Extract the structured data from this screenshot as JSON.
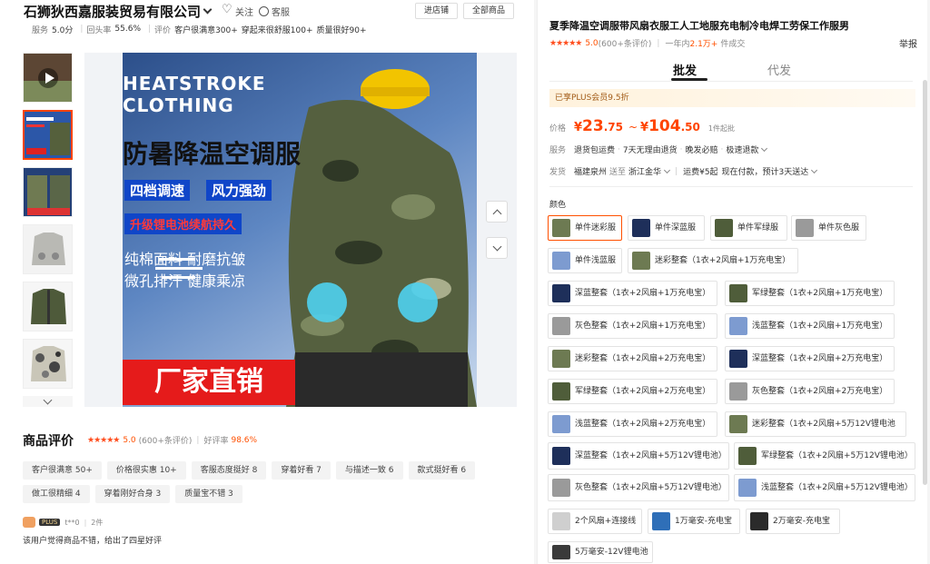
{
  "shop": {
    "name": "石狮狄西嘉服装贸易有限公司",
    "follow": "关注",
    "service": "客服",
    "enter_store": "进店铺",
    "all_products": "全部商品"
  },
  "ratings": {
    "service_label": "服务",
    "service_score": "5.0分",
    "repeat_label": "回头率",
    "repeat_value": "55.6%",
    "review_label": "评价",
    "tags": [
      "客户很满意300+",
      "穿起来很舒服100+",
      "质量很好90+"
    ]
  },
  "gallery": {
    "thumb_icons": [
      "video-thumb-icon",
      "thumb-blue-icon",
      "thumb-camo-icon",
      "thumb-grey-icon",
      "thumb-green-icon",
      "thumb-camo2-icon"
    ],
    "banner_en1": "HEATSTROKE",
    "banner_en2": "CLOTHING",
    "banner_title": "防暑降温空调服",
    "badge1": "四档调速",
    "badge2": "风力强劲",
    "badge3": "升级锂电池续航持久",
    "feat1": "纯棉面料 耐磨抗皱",
    "feat2": "微孔排汗 健康乘凉",
    "bottom_banner": "厂家直销"
  },
  "reviews": {
    "title": "商品评价",
    "score": "5.0",
    "count": "(600+条评价)",
    "good_label": "好评率",
    "good_rate": "98.6%",
    "tags": [
      "客户很满意 50+",
      "价格很实惠 10+",
      "客服态度挺好 8",
      "穿着好看 7",
      "与描述一致 6",
      "款式挺好看 6",
      "做工很精细 4",
      "穿着刚好合身 3",
      "质量宝不错 3"
    ],
    "user_badge": "PLUS",
    "user_name": "t**0",
    "user_count": "2件",
    "text": "该用户觉得商品不错，给出了四星好评"
  },
  "product": {
    "title": "夏季降温空调服带风扇衣服工人工地服充电制冷电焊工劳保工作服男",
    "score": "5.0",
    "count": "(600+条评价)",
    "sales_prefix": "一年内",
    "sales": "2.1万+",
    "sales_suffix": "件成交",
    "report": "举报",
    "tabs": [
      "批发",
      "代发"
    ],
    "plus_bar": "已享PLUS会员9.5折",
    "price_label": "价格",
    "currency": "¥",
    "price_low_int": "23",
    "price_low_dec": ".75",
    "tilde": "~",
    "price_high_int": "104",
    "price_high_dec": ".50",
    "min_order": "1件起批",
    "service_label": "服务",
    "services": [
      "退货包运费",
      "7天无理由退货",
      "晚发必赔",
      "极速退款"
    ],
    "ship_label": "发货",
    "ship_from": "福建泉州",
    "ship_to_word": "送至",
    "ship_to": "浙江金华",
    "ship_fee": "运费¥5起",
    "ship_note": "现在付款，预计3天送达",
    "color_label": "颜色",
    "options": [
      {
        "label": "单件迷彩服",
        "color": "#6d7a52"
      },
      {
        "label": "单件深蓝服",
        "color": "#1e2f5a"
      },
      {
        "label": "单件军绿服",
        "color": "#4f5d3a"
      },
      {
        "label": "单件灰色服",
        "color": "#9a9a9a"
      },
      {
        "label": "单件浅蓝服",
        "color": "#7d9bd0"
      },
      {
        "label": "迷彩整套（1衣+2风扇+1万充电宝）",
        "color": "#6d7a52"
      },
      {
        "label": "深蓝整套（1衣+2风扇+1万充电宝）",
        "color": "#1e2f5a"
      },
      {
        "label": "军绿整套（1衣+2风扇+1万充电宝）",
        "color": "#4f5d3a"
      },
      {
        "label": "灰色整套（1衣+2风扇+1万充电宝）",
        "color": "#9a9a9a"
      },
      {
        "label": "浅蓝整套（1衣+2风扇+1万充电宝）",
        "color": "#7d9bd0"
      },
      {
        "label": "迷彩整套（1衣+2风扇+2万充电宝）",
        "color": "#6d7a52"
      },
      {
        "label": "深蓝整套（1衣+2风扇+2万充电宝）",
        "color": "#1e2f5a"
      },
      {
        "label": "军绿整套（1衣+2风扇+2万充电宝）",
        "color": "#4f5d3a"
      },
      {
        "label": "灰色整套（1衣+2风扇+2万充电宝）",
        "color": "#9a9a9a"
      },
      {
        "label": "浅蓝整套（1衣+2风扇+2万充电宝）",
        "color": "#7d9bd0"
      },
      {
        "label": "迷彩整套（1衣+2风扇+5万12V锂电池",
        "color": "#6d7a52"
      },
      {
        "label": "深蓝整套（1衣+2风扇+5万12V锂电池）",
        "color": "#1e2f5a"
      },
      {
        "label": "军绿整套（1衣+2风扇+5万12V锂电池）",
        "color": "#4f5d3a"
      },
      {
        "label": "灰色整套（1衣+2风扇+5万12V锂电池）",
        "color": "#9a9a9a"
      },
      {
        "label": "浅蓝整套（1衣+2风扇+5万12V锂电池）",
        "color": "#7d9bd0"
      },
      {
        "label": "2个风扇+连接线",
        "color": "#cfcfcf"
      },
      {
        "label": "1万毫安-充电宝",
        "color": "#2f6fb8"
      },
      {
        "label": "2万毫安-充电宝",
        "color": "#2b2b2b"
      },
      {
        "label": "5万毫安-12V锂电池",
        "color": "#3a3a3a"
      }
    ]
  },
  "colors": {
    "accent": "#ff4400",
    "plus_text": "#a05a16"
  }
}
